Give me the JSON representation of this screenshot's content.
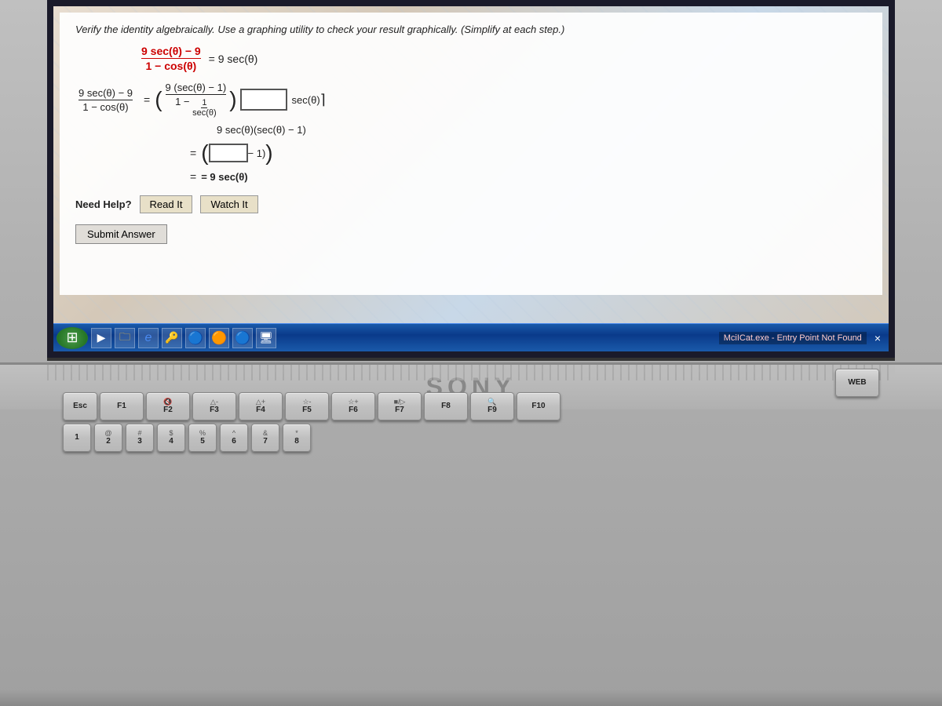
{
  "screen": {
    "problem": {
      "title": "Verify the identity algebraically. Use a graphing utility to check your result graphically. (Simplify at each step.)",
      "equation_header": {
        "numerator": "9 sec(θ) − 9",
        "denominator": "1 − cos(θ)",
        "equals": "= 9 sec(θ)"
      },
      "step1_lhs_num": "9 sec(θ) − 9",
      "step1_lhs_den": "1 − cos(θ)",
      "step1_factor1_num": "9 (sec(θ) − 1)",
      "step1_factor1_den_top": "1",
      "step1_factor1_den_mid": "1 −",
      "step1_factor1_den_bot": "sec(θ)",
      "step1_factor2_label": "sec(θ)",
      "step2_line": "9 sec(θ)(sec(θ) − 1)",
      "step2_result": "− 1)",
      "step3_result": "= 9 sec(θ)"
    },
    "need_help": {
      "label": "Need Help?",
      "read_it_btn": "Read It",
      "watch_it_btn": "Watch It"
    },
    "submit_btn": "Submit Answer"
  },
  "taskbar": {
    "start_label": "⊞",
    "app_icons": [
      "▶",
      "🗀",
      "e",
      "🔑"
    ],
    "app_circles": [
      "🔵",
      "🟠",
      "🔵"
    ],
    "notification": "MciICat.exe - Entry Point Not Found",
    "close_x": "×"
  },
  "keyboard": {
    "fn_row": [
      "Esc",
      "F1",
      "F2",
      "F3",
      "F4",
      "F5",
      "F6",
      "F7",
      "F8",
      "F9",
      "F10"
    ],
    "fn_row_sub": [
      "",
      "",
      "🔇",
      "△-",
      "△+",
      "☆-",
      "☆+",
      "■/▷",
      "",
      "🔍",
      ""
    ],
    "number_row": [
      "1",
      "2",
      "@",
      "#",
      "$",
      "%",
      "^",
      "&",
      "*",
      "("
    ],
    "special_keys": [
      "WEB"
    ]
  },
  "laptop": {
    "brand": "SONY"
  }
}
